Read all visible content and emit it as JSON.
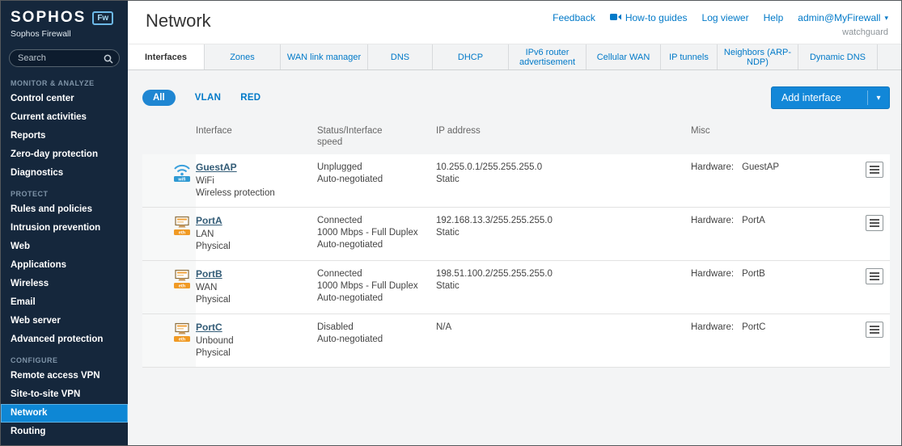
{
  "sidebar": {
    "logo": "SOPHOS",
    "logo_badge": "Fw",
    "subtitle": "Sophos Firewall",
    "search_placeholder": "Search",
    "sections": [
      {
        "label": "MONITOR & ANALYZE",
        "items": [
          "Control center",
          "Current activities",
          "Reports",
          "Zero-day protection",
          "Diagnostics"
        ]
      },
      {
        "label": "PROTECT",
        "items": [
          "Rules and policies",
          "Intrusion prevention",
          "Web",
          "Applications",
          "Wireless",
          "Email",
          "Web server",
          "Advanced protection"
        ]
      },
      {
        "label": "CONFIGURE",
        "items": [
          "Remote access VPN",
          "Site-to-site VPN",
          "Network",
          "Routing"
        ]
      }
    ],
    "active_item": "Network"
  },
  "header": {
    "title": "Network",
    "links": {
      "feedback": "Feedback",
      "howto": "How-to guides",
      "logviewer": "Log viewer",
      "help": "Help"
    },
    "user": "admin@MyFirewall",
    "org": "watchguard"
  },
  "tabs": [
    "Interfaces",
    "Zones",
    "WAN link manager",
    "DNS",
    "DHCP",
    "IPv6 router advertisement",
    "Cellular WAN",
    "IP tunnels",
    "Neighbors (ARP-NDP)",
    "Dynamic DNS"
  ],
  "active_tab": "Interfaces",
  "filters": [
    "All",
    "VLAN",
    "RED"
  ],
  "active_filter": "All",
  "toolbar": {
    "add_button": "Add interface"
  },
  "table": {
    "columns": [
      "Interface",
      "Status/Interface speed",
      "IP address",
      "Misc"
    ],
    "rows": [
      {
        "icon": "wifi",
        "name": "GuestAP",
        "zone": "WiFi",
        "type": "Wireless protection",
        "status": [
          "Unplugged",
          "Auto-negotiated"
        ],
        "ip": [
          "10.255.0.1/255.255.255.0",
          "Static"
        ],
        "misc_label": "Hardware:",
        "misc_value": "GuestAP"
      },
      {
        "icon": "eth",
        "name": "PortA",
        "zone": "LAN",
        "type": "Physical",
        "status": [
          "Connected",
          "1000 Mbps - Full Duplex",
          "Auto-negotiated"
        ],
        "ip": [
          "192.168.13.3/255.255.255.0",
          "Static"
        ],
        "misc_label": "Hardware:",
        "misc_value": "PortA"
      },
      {
        "icon": "eth",
        "name": "PortB",
        "zone": "WAN",
        "type": "Physical",
        "status": [
          "Connected",
          "1000 Mbps - Full Duplex",
          "Auto-negotiated"
        ],
        "ip": [
          "198.51.100.2/255.255.255.0",
          "Static"
        ],
        "misc_label": "Hardware:",
        "misc_value": "PortB"
      },
      {
        "icon": "eth",
        "name": "PortC",
        "zone": "Unbound",
        "type": "Physical",
        "status": [
          "Disabled",
          "Auto-negotiated"
        ],
        "ip": [
          "N/A"
        ],
        "misc_label": "Hardware:",
        "misc_value": "PortC"
      }
    ]
  }
}
